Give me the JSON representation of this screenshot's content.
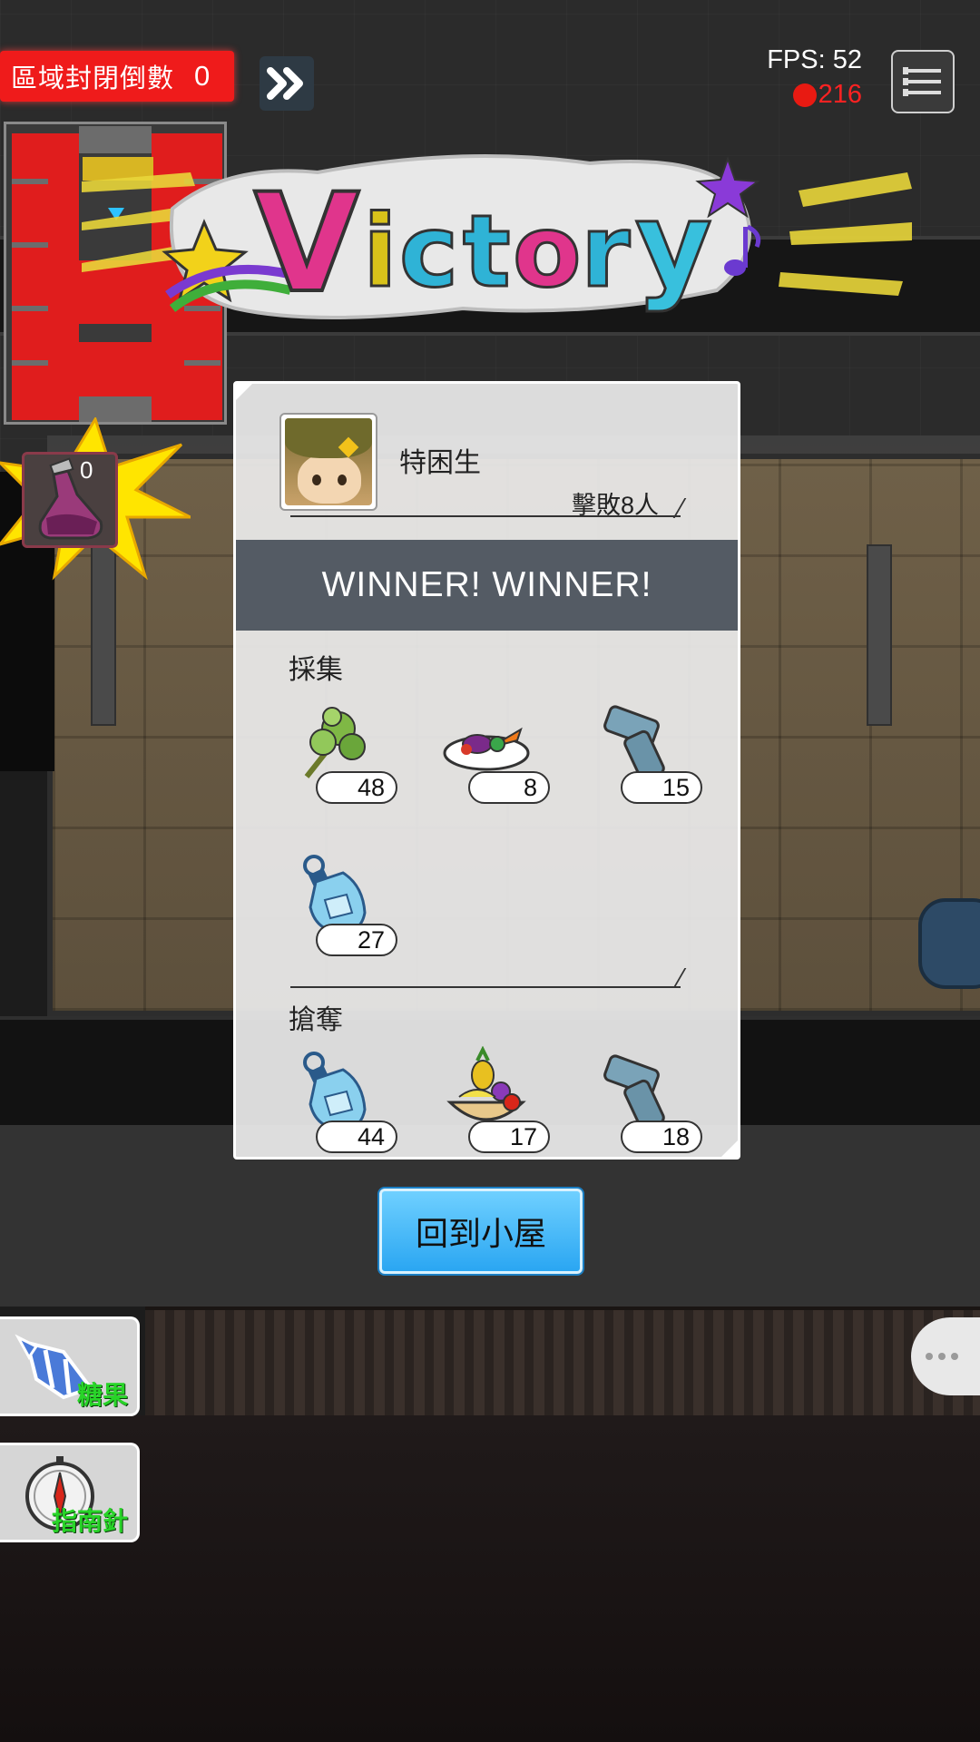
{
  "hud": {
    "countdown_label": "區域封閉倒數",
    "countdown_value": "0",
    "fps": "FPS: 52",
    "ping": "216",
    "potion_count": "0"
  },
  "banner": {
    "text": "Victory"
  },
  "result": {
    "player_name": "特困生",
    "defeated": "擊敗8人",
    "winner": "WINNER! WINNER!",
    "gather_label": "採集",
    "plunder_label": "搶奪",
    "gather_items": [
      {
        "icon": "herb-icon",
        "count": "48"
      },
      {
        "icon": "food-plate-icon",
        "count": "8"
      },
      {
        "icon": "pipe-icon",
        "count": "15"
      },
      {
        "icon": "water-bottle-icon",
        "count": "27"
      }
    ],
    "plunder_items": [
      {
        "icon": "water-bottle-icon",
        "count": "44"
      },
      {
        "icon": "fruit-basket-icon",
        "count": "17"
      },
      {
        "icon": "pipe-icon",
        "count": "18"
      }
    ]
  },
  "actions": {
    "return_home": "回到小屋"
  },
  "side_items": [
    {
      "icon": "candy-icon",
      "label": "糖果"
    },
    {
      "icon": "compass-icon",
      "label": "指南針"
    }
  ],
  "colors": {
    "countdown_red": "#ef1b1b",
    "winner_bar": "#545b64",
    "return_blue": "#2aa6f2",
    "side_label_green": "#28d428"
  }
}
